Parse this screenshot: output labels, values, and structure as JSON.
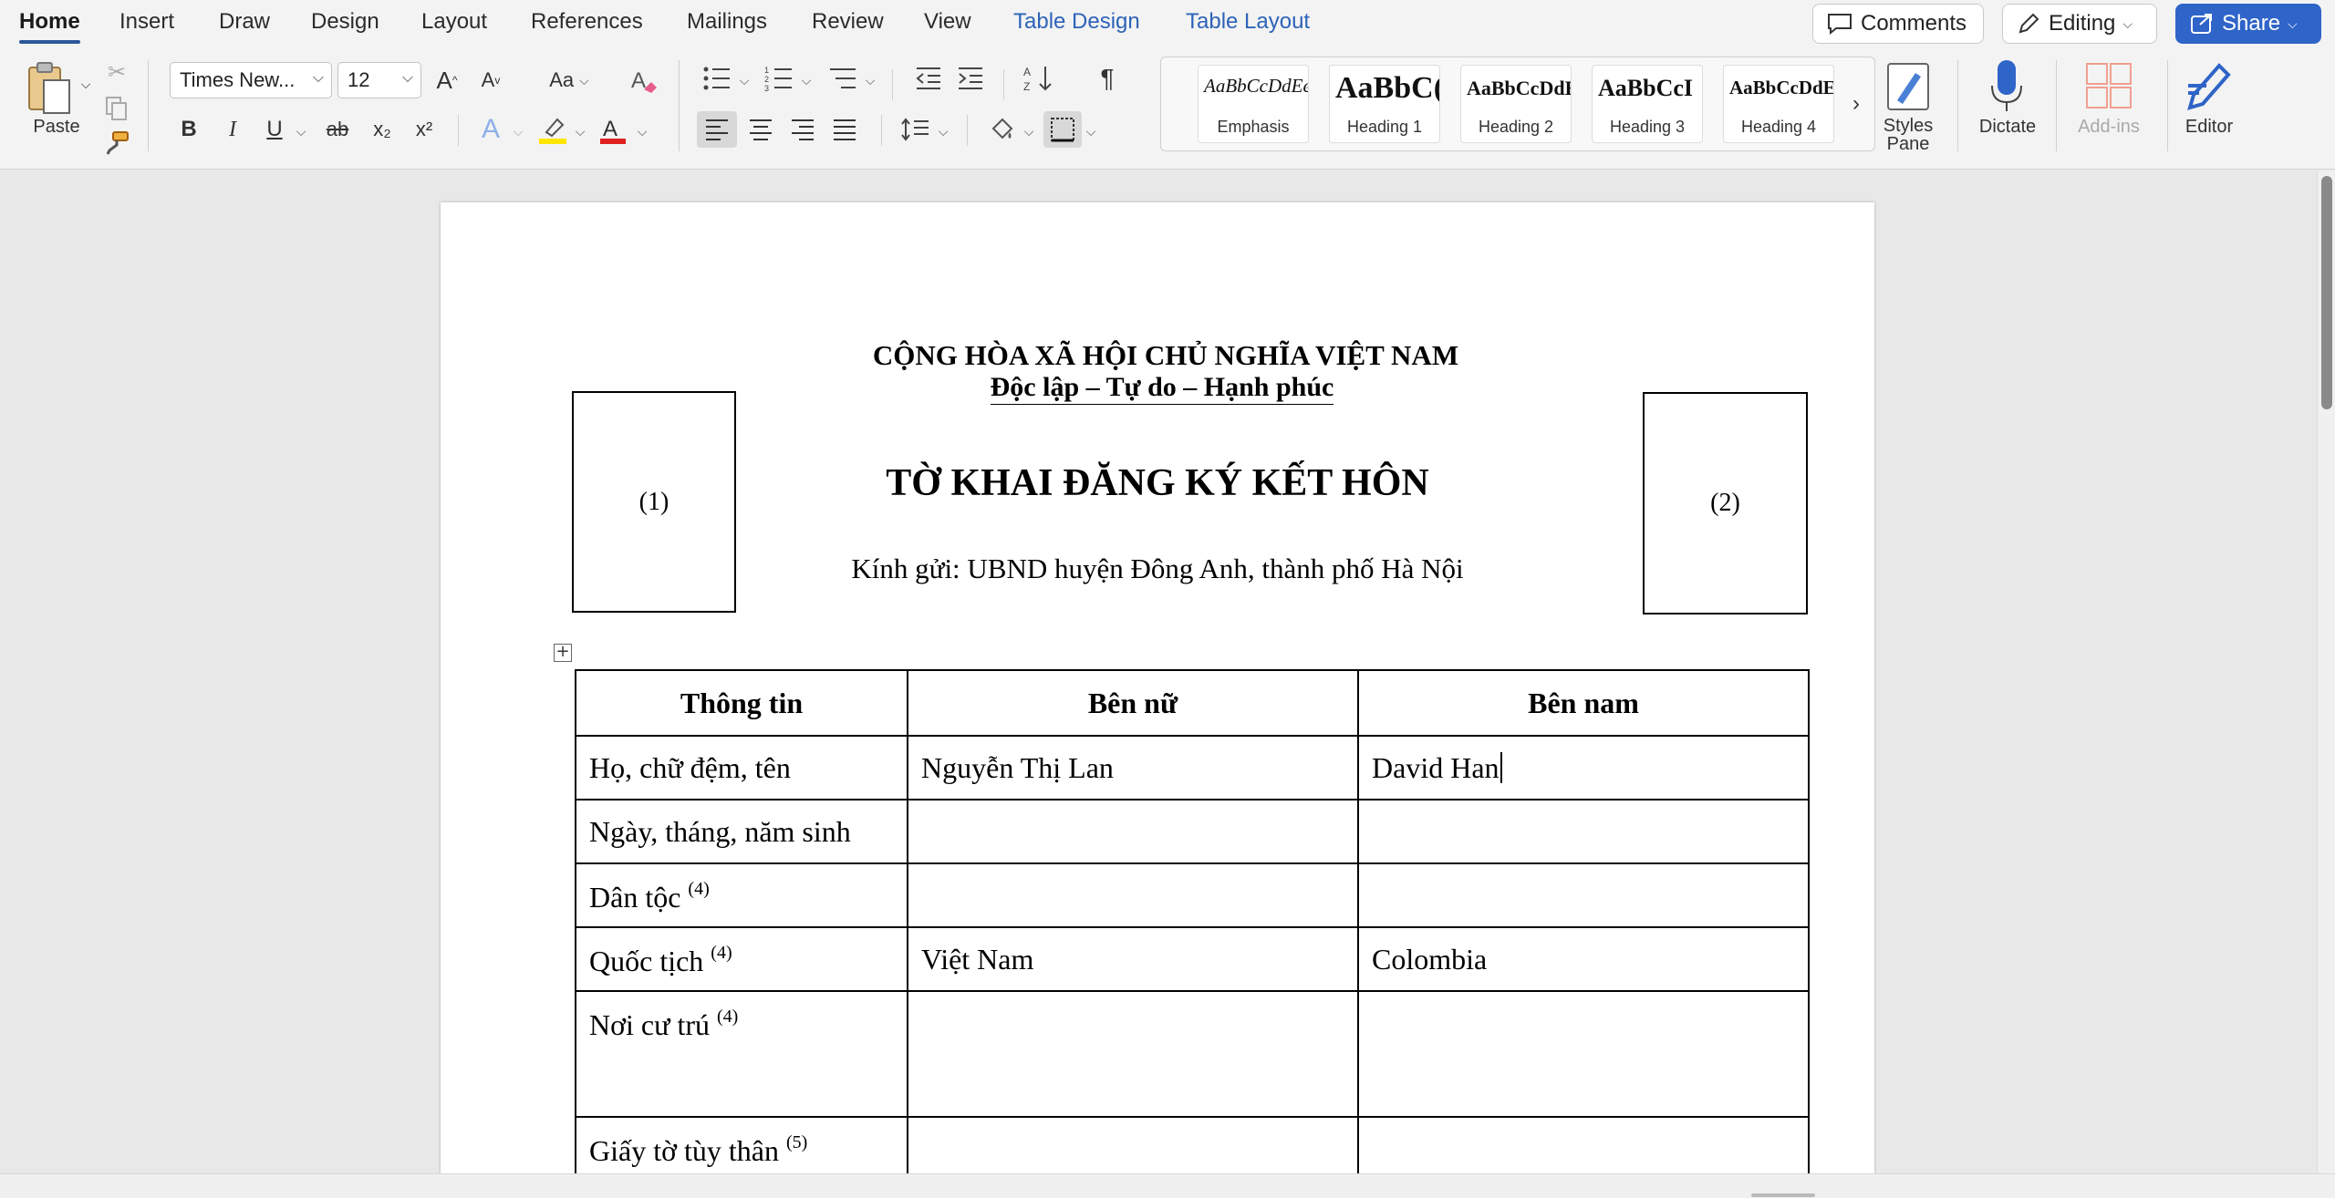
{
  "tabs": [
    {
      "label": "Home",
      "active": true
    },
    {
      "label": "Insert"
    },
    {
      "label": "Draw"
    },
    {
      "label": "Design"
    },
    {
      "label": "Layout"
    },
    {
      "label": "References"
    },
    {
      "label": "Mailings"
    },
    {
      "label": "Review"
    },
    {
      "label": "View"
    },
    {
      "label": "Table Design",
      "contextual": true
    },
    {
      "label": "Table Layout",
      "contextual": true
    }
  ],
  "topbar": {
    "comments_label": "Comments",
    "editing_label": "Editing",
    "share_label": "Share"
  },
  "ribbon": {
    "paste_label": "Paste",
    "font_name": "Times New...",
    "font_size": "12",
    "bold": "B",
    "italic": "I",
    "underline": "U",
    "strike": "ab",
    "subscript": "x₂",
    "superscript": "x²",
    "grow_font": "A",
    "shrink_font": "A",
    "change_case": "Aa",
    "styles": [
      {
        "sample": "AaBbCcDdEe",
        "name": "Emphasis"
      },
      {
        "sample": "AaBbC(",
        "name": "Heading 1"
      },
      {
        "sample": "AaBbCcDdE",
        "name": "Heading 2"
      },
      {
        "sample": "AaBbCcI",
        "name": "Heading 3"
      },
      {
        "sample": "AaBbCcDdE",
        "name": "Heading 4"
      }
    ],
    "styles_pane_label": "Styles\nPane",
    "dictate_label": "Dictate",
    "addins_label": "Add-ins",
    "editor_label": "Editor"
  },
  "colors": {
    "accent": "#2b579a",
    "contextual_tab": "#2d63b8",
    "share_bg": "#2f64c8",
    "highlight_yellow": "#ffe600",
    "font_color_red": "#e02020"
  },
  "document": {
    "national_title": "CỘNG HÒA XÃ HỘI CHỦ NGHĨA VIỆT NAM",
    "motto": "Độc lập – Tự do – Hạnh phúc",
    "form_title": "TỜ KHAI ĐĂNG KÝ KẾT HÔN",
    "addressee": "Kính gửi: UBND huyện Đông Anh, thành phố Hà Nội",
    "photo_left": "(1)",
    "photo_right": "(2)",
    "table": {
      "headers": [
        "Thông tin",
        "Bên nữ",
        "Bên nam"
      ],
      "rows": [
        {
          "label": "Họ, chữ đệm, tên",
          "note": "",
          "female": "Nguyễn Thị Lan",
          "male": "David Han"
        },
        {
          "label": "Ngày, tháng, năm sinh",
          "note": "",
          "female": "",
          "male": ""
        },
        {
          "label": "Dân tộc",
          "note": "(4)",
          "female": "",
          "male": ""
        },
        {
          "label": "Quốc tịch",
          "note": "(4)",
          "female": "Việt Nam",
          "male": "Colombia"
        },
        {
          "label": "Nơi cư trú",
          "note": "(4)",
          "female": "",
          "male": ""
        },
        {
          "label": "Giấy tờ tùy thân",
          "note": "(5)",
          "female": "",
          "male": ""
        }
      ]
    }
  }
}
